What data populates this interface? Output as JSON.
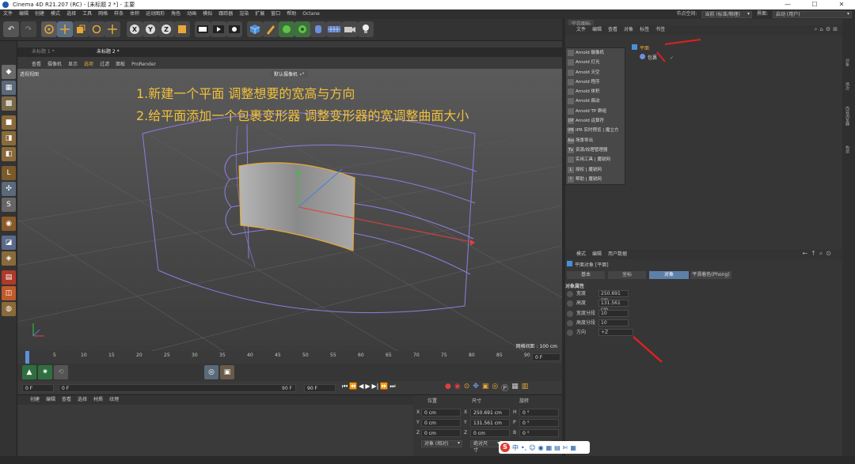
{
  "window": {
    "title": "Cinema 4D R21.207 (RC) - [未标题 2 *] - 主要",
    "controls": [
      "—",
      "☐",
      "✕"
    ]
  },
  "menubar": {
    "items": [
      "文件",
      "编辑",
      "创建",
      "模式",
      "选择",
      "工具",
      "网格",
      "样条",
      "体积",
      "运动图形",
      "角色",
      "动画",
      "模拟",
      "跟踪器",
      "渲染",
      "扩展",
      "窗口",
      "帮助",
      "Octane"
    ],
    "node_space_label": "节点空间:",
    "node_space_value": "当前 (标准/物理)",
    "interface_label": "界面:",
    "interface_value": "启动 (用户)"
  },
  "toolbar": {
    "icons": [
      "undo-icon",
      "redo-icon",
      "live-select-icon",
      "move-icon",
      "scale-icon",
      "rotate-icon",
      "add-icon",
      "x-axis-icon",
      "y-axis-icon",
      "z-axis-icon",
      "coordinate-icon",
      "render-view-icon",
      "render-picture-icon",
      "render-settings-icon",
      "cube-icon",
      "pen-icon",
      "subdivision-icon",
      "cloner-icon",
      "deformer-icon",
      "floor-icon",
      "camera-icon",
      "light-icon"
    ],
    "axis_labels": [
      "X",
      "Y",
      "Z"
    ]
  },
  "viewport": {
    "tabs": [
      "未标题 1 *",
      "未标题 2 *"
    ],
    "menu": [
      "查看",
      "摄像机",
      "显示",
      "选项",
      "过滤",
      "面板",
      "ProRender"
    ],
    "view_name": "透视视图",
    "camera": "默认摄像机 ∘°",
    "grid_spacing": "网格间距 : 100 cm",
    "note_line1": "1.新建一个平面 调整想要的宽高与方向",
    "note_line2": "2.给平面添加一个包裹变形器 调整变形器的宽调整曲面大小"
  },
  "timeline": {
    "ticks": [
      "0",
      "5",
      "10",
      "15",
      "20",
      "25",
      "30",
      "35",
      "40",
      "45",
      "50",
      "55",
      "60",
      "65",
      "70",
      "75",
      "80",
      "85",
      "90"
    ],
    "current": "0 F"
  },
  "frames": {
    "start": "0 F",
    "preview_start": "0 F",
    "end": "90 F",
    "preview_end": "90 F"
  },
  "material": {
    "menu": [
      "创建",
      "编辑",
      "查看",
      "选择",
      "材质",
      "纹理"
    ]
  },
  "coordinates": {
    "headers": [
      "位置",
      "尺寸",
      "旋转"
    ],
    "rows": [
      {
        "axis": "X",
        "pos": "0 cm",
        "size_axis": "X",
        "size": "250.691 cm",
        "rot_axis": "H",
        "rot": "0 °"
      },
      {
        "axis": "Y",
        "pos": "0 cm",
        "size_axis": "Y",
        "size": "131.561 cm",
        "rot_axis": "P",
        "rot": "0 °"
      },
      {
        "axis": "Z",
        "pos": "0 cm",
        "size_axis": "Z",
        "size": "0 cm",
        "rot_axis": "B",
        "rot": "0 °"
      }
    ],
    "mode": "对象 (相对)",
    "size_mode": "绝对尺寸",
    "apply": "应用"
  },
  "objects": {
    "tab_title": "空白图标",
    "menu": [
      "文件",
      "编辑",
      "查看",
      "对象",
      "标签",
      "书签"
    ],
    "items": [
      {
        "name": "平面"
      },
      {
        "name": "包裹"
      }
    ],
    "arnold_menu": [
      {
        "icon": "",
        "label": "Arnold 摄像机"
      },
      {
        "icon": "",
        "label": "Arnold 灯光"
      },
      {
        "icon": "",
        "label": "Arnold 天空"
      },
      {
        "icon": "",
        "label": "Arnold 程序"
      },
      {
        "icon": "",
        "label": "Arnold 体积"
      },
      {
        "icon": "",
        "label": "Arnold 扁动"
      },
      {
        "icon": "",
        "label": "Arnold TP 群组"
      },
      {
        "icon": "OP",
        "label": "Arnold 运算符"
      },
      {
        "icon": "IPR",
        "label": "IPR 实时预览 | 魔立方"
      },
      {
        "icon": "Ass",
        "label": "场景导出"
      },
      {
        "icon": "Tx",
        "label": "资源/纹理管理器"
      },
      {
        "icon": "",
        "label": "实用工具 | 魔锐网"
      },
      {
        "icon": "L",
        "label": "授权 | 魔锐网"
      },
      {
        "icon": "?",
        "label": "帮助 | 魔锐网"
      }
    ]
  },
  "attributes": {
    "menu": [
      "模式",
      "编辑",
      "用户数据"
    ],
    "object_title": "平面对象 [平面]",
    "tabs": [
      "基本",
      "坐标",
      "对象",
      "平滑着色(Phong)"
    ],
    "section": "对象属性",
    "fields": [
      {
        "label": "宽度",
        "value": "250.691 cm"
      },
      {
        "label": "高度",
        "value": "131.561 cm"
      },
      {
        "label": "宽度分段",
        "value": "10"
      },
      {
        "label": "高度分段",
        "value": "10"
      },
      {
        "label": "方向",
        "value": "+Z"
      }
    ]
  },
  "side_tabs": [
    "对象",
    "场次",
    "内容浏览器",
    "构造"
  ],
  "ime": {
    "text": "中"
  }
}
